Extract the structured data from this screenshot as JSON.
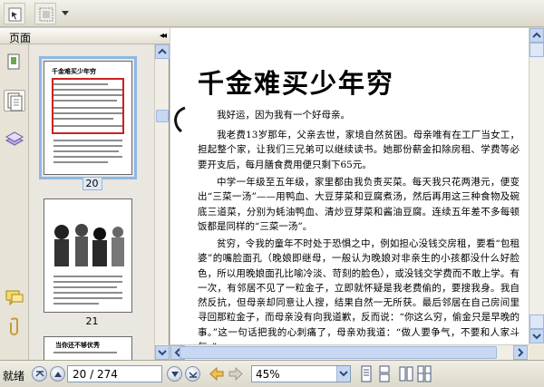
{
  "toolbar": {
    "tools": [
      "select-text-icon",
      "snapshot-icon"
    ]
  },
  "nav_panel": {
    "header_label": "页面",
    "collapse_glyph": "◂◂",
    "side_icons": [
      "pages-icon",
      "bookmarks-icon",
      "layers-icon",
      "comments-icon",
      "attachments-icon"
    ],
    "thumbnails": [
      {
        "page_label": "20",
        "selected": true,
        "title": "千金难买少年穷"
      },
      {
        "page_label": "21",
        "selected": false
      },
      {
        "page_label": "",
        "selected": false,
        "title": "当你还不够优秀"
      }
    ]
  },
  "document": {
    "title": "千金难买少年穷",
    "paragraphs": [
      "我好运，因为我有一个好母亲。",
      "我老费13岁那年，父亲去世，家境自然贫困。母亲唯有在工厂当女工，担起整个家，让我们三兄弟可以继续读书。她那份薪金扣除房租、学费等必要开支后，每月膳食费用便只剩下65元。",
      "中学一年级至五年级，家里都由我负责买菜。每天我只花两港元，便变出“三菜一汤”——用鸭血、大豆芽菜和豆腐煮汤，然后再用这三种食物及碗底三道菜，分别为蚝油鸭血、清炒豆芽菜和酱油豆腐。连续五年差不多每顿饭都是同样的“三菜一汤”。",
      "贫穷，令我的童年不时处于恐惧之中，例如担心没钱交房租，要看“包租婆”的嘴脸面孔（晚娘即继母，一般认为晚娘对非亲生的小孩都没什么好脸色，所以用晚娘面孔比喻冷淡、苛刻的脸色），或没钱交学费而不敢上学。有一次，有邻居不见了一粒金子，立即就怀疑是我老费偷的，要搜我身。我自然反抗，但母亲却同意让人搜，结果自然一无所获。最后邻居在自己房间里寻回那粒金子，而母亲没有向我道歉，反而说：“你这么穷，偷金只是早晚的事。”这一句话把我的心刺痛了，母亲劝我道：“做人要争气，不要和人家斗气。”"
    ]
  },
  "status_bar": {
    "status_text": "就绪",
    "page_field": "20 / 274",
    "zoom_value": "45%"
  }
}
